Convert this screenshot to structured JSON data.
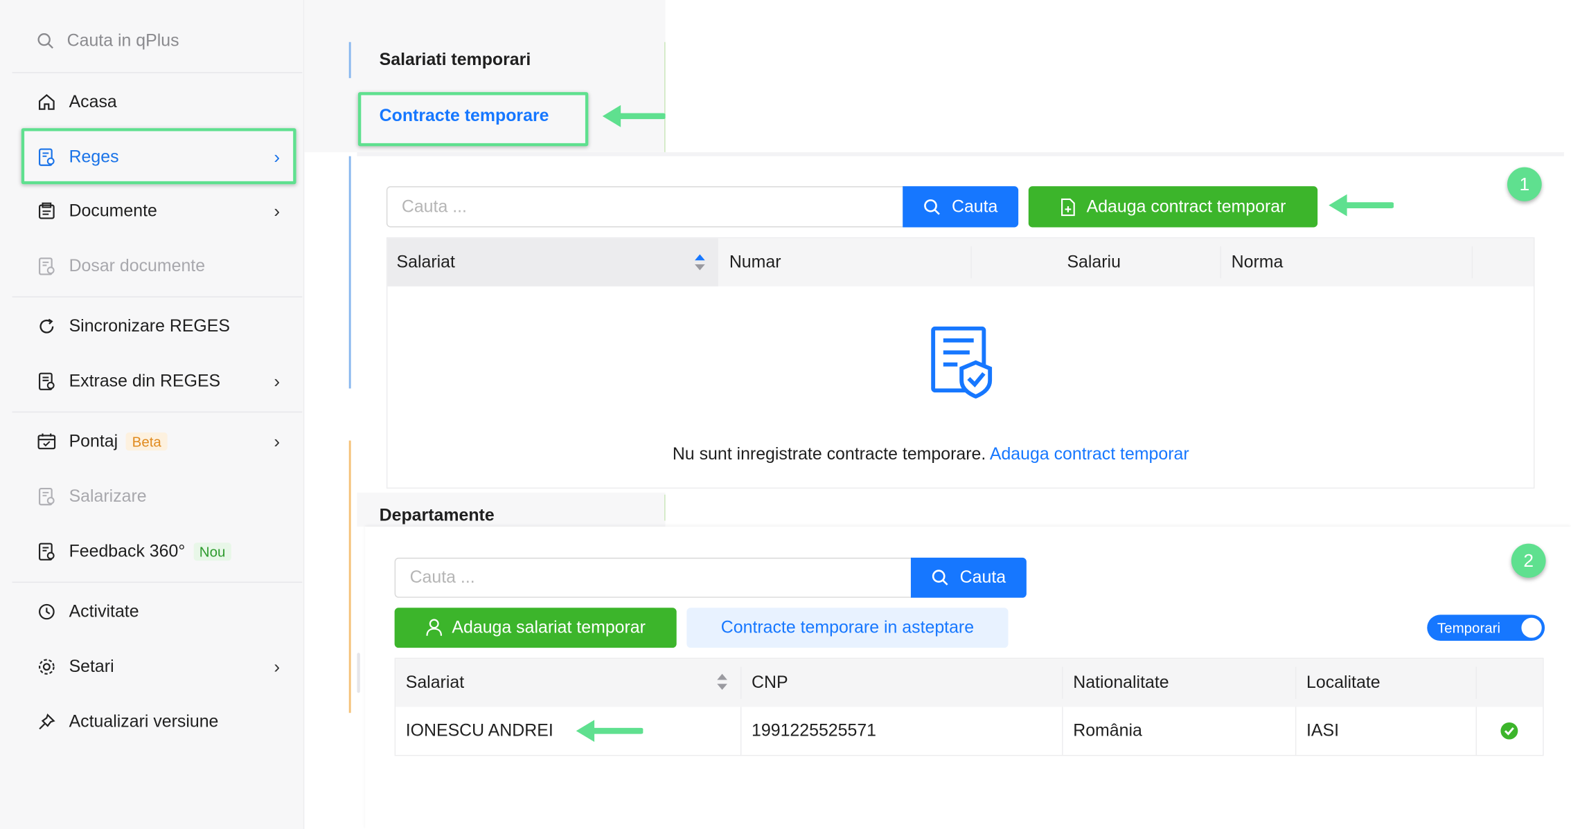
{
  "sidebar": {
    "search_placeholder": "Cauta in qPlus",
    "items": [
      {
        "label": "Acasa"
      },
      {
        "label": "Reges"
      },
      {
        "label": "Documente"
      },
      {
        "label": "Dosar documente"
      },
      {
        "label": "Sincronizare REGES"
      },
      {
        "label": "Extrase din REGES"
      },
      {
        "label": "Pontaj",
        "tag": "Beta"
      },
      {
        "label": "Salarizare"
      },
      {
        "label": "Feedback 360°",
        "tag": "Nou"
      },
      {
        "label": "Activitate"
      },
      {
        "label": "Setari"
      },
      {
        "label": "Actualizari versiune"
      }
    ]
  },
  "subnav": {
    "heading": "Salariati temporari",
    "active_item": "Contracte temporare",
    "section2": "Departamente"
  },
  "contracts": {
    "step": "1",
    "search_placeholder": "Cauta ...",
    "search_button": "Cauta",
    "add_button": "Adauga contract temporar",
    "columns": [
      "Salariat",
      "Numar",
      "Salariu",
      "Norma"
    ],
    "empty_text": "Nu sunt inregistrate contracte temporare.",
    "empty_link": "Adauga contract temporar"
  },
  "employees": {
    "step": "2",
    "search_placeholder": "Cauta ...",
    "search_button": "Cauta",
    "add_button": "Adauga salariat temporar",
    "pending_button": "Contracte temporare in asteptare",
    "toggle_label": "Temporari",
    "columns": [
      "Salariat",
      "CNP",
      "Nationalitate",
      "Localitate"
    ],
    "rows": [
      {
        "name": "IONESCU ANDREI",
        "cnp": "1991225525571",
        "nationality": "România",
        "city": "IASI"
      }
    ]
  },
  "colors": {
    "accent": "#1677ff",
    "green_button": "#3cb52b",
    "highlight": "#5fe08f"
  }
}
